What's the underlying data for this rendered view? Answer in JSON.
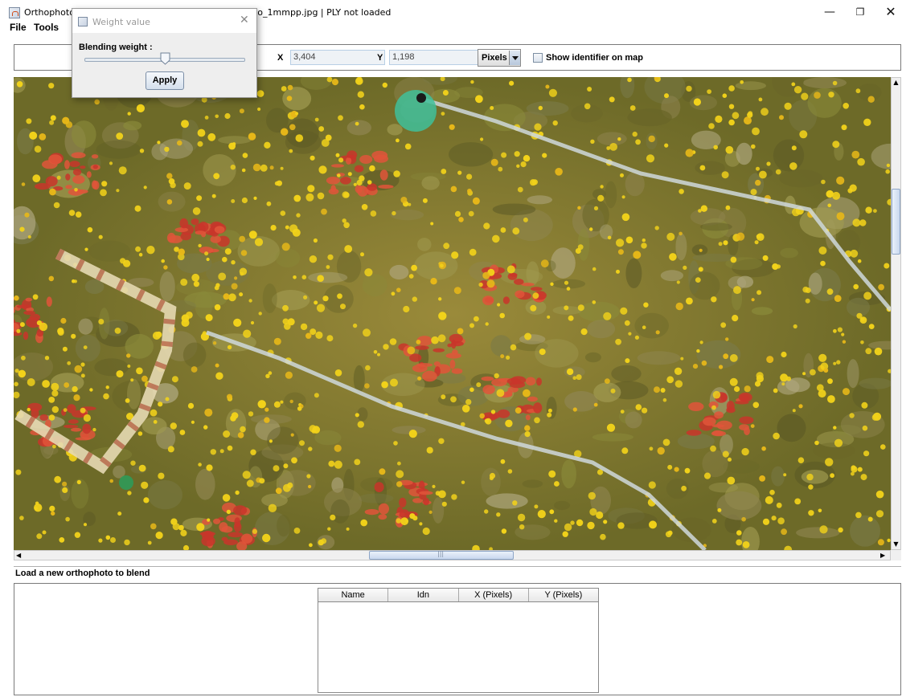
{
  "window": {
    "title": "Orthophoto : Reference Scene 20161015 · orthophoto_1mmpp.jpg | PLY not loaded",
    "controls": {
      "minimize": "—",
      "maximize": "❐",
      "close": "✕"
    }
  },
  "menu": {
    "file": "File",
    "tools": "Tools"
  },
  "toolbar": {
    "x_label": "X",
    "x_value": "3,404",
    "y_label": "Y",
    "y_value": "1,198",
    "units_selected": "Pixels",
    "show_identifier_label": "Show identifier on map",
    "show_identifier_checked": false
  },
  "dialog": {
    "title": "Weight value",
    "close": "✕",
    "blending_label": "Blending weight :",
    "slider_value_fraction": 0.5,
    "apply_label": "Apply"
  },
  "scroll": {
    "up": "▲",
    "down": "▼",
    "left": "◀",
    "right": "▶",
    "grip": "|||",
    "vertical_position_fraction": 0.27,
    "horizontal_position_fraction": 0.45
  },
  "status": {
    "text": "Load a  new orthophoto to blend"
  },
  "table": {
    "columns": [
      "Name",
      "Idn",
      "X (Pixels)",
      "Y (Pixels)"
    ],
    "rows": []
  },
  "colors": {
    "map_base": "#7d7a2c",
    "sponge_yellow": "#f2d21a",
    "coral_red": "#c9352a",
    "frame_bg": "#ffffff"
  }
}
